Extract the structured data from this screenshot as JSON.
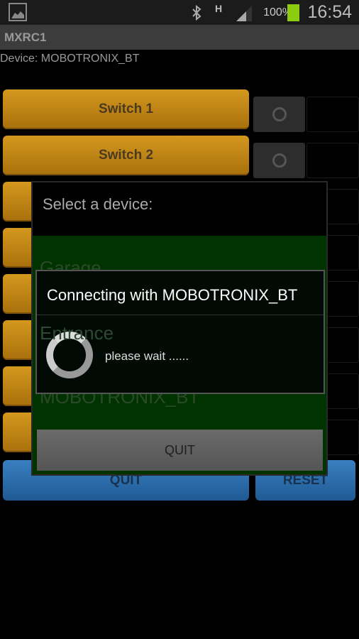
{
  "status": {
    "time": "16:54",
    "battery": "100%",
    "battery_level": 100,
    "network": "H",
    "icons": [
      "gallery-icon",
      "bluetooth-icon",
      "signal-icon",
      "battery-icon"
    ]
  },
  "app": {
    "title": "MXRC1",
    "device_label": "Device: MOBOTRONIX_BT"
  },
  "switches": [
    {
      "label": "Switch 1"
    },
    {
      "label": "Switch 2"
    }
  ],
  "buttons": {
    "quit": "QUIT",
    "reset": "RESET"
  },
  "device_dialog": {
    "title": "Select a device:",
    "items": [
      "Garage",
      "Entrance",
      "MOBOTRONIX_BT"
    ],
    "quit": "QUIT"
  },
  "progress_dialog": {
    "title": "Connecting with MOBOTRONIX_BT",
    "message": "please wait ......"
  }
}
